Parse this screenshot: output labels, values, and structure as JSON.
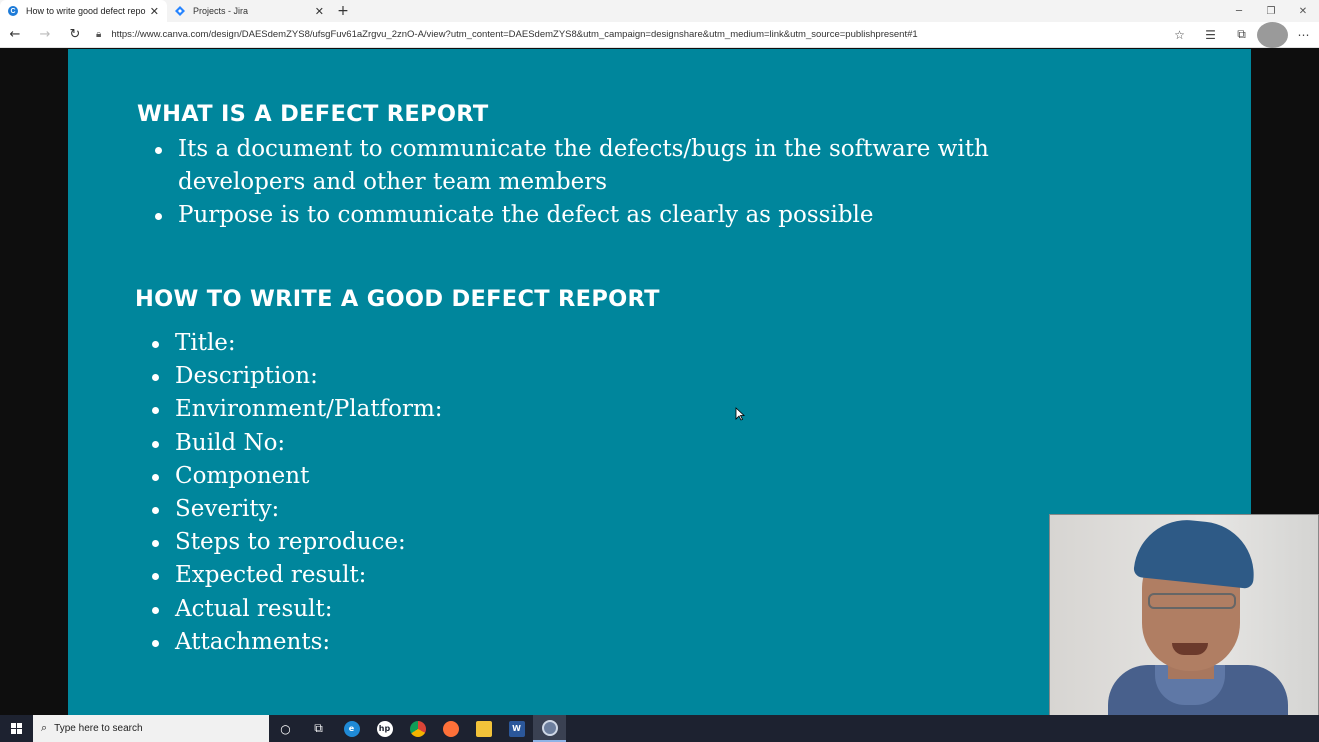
{
  "browser": {
    "tabs": [
      {
        "title": "How to write good defect report",
        "active": true,
        "icon": "canva-icon"
      },
      {
        "title": "Projects - Jira",
        "active": false,
        "icon": "jira-icon"
      }
    ],
    "url": "https://www.canva.com/design/DAESdemZYS8/ufsgFuv61aZrgvu_2znO-A/view?utm_content=DAESdemZYS8&utm_campaign=designshare&utm_medium=link&utm_source=publishpresent#1"
  },
  "slide": {
    "section1": {
      "heading": "WHAT IS A DEFECT REPORT",
      "bullets": [
        "Its a document to communicate the defects/bugs in the software with",
        "developers and other team members",
        "Purpose is to communicate the defect as clearly as possible"
      ]
    },
    "section2": {
      "heading": "HOW TO WRITE A GOOD DEFECT REPORT",
      "bullets": [
        "Title:",
        "Description:",
        "Environment/Platform:",
        "Build No:",
        "Component",
        "Severity:",
        "Steps to reproduce:",
        "Expected result:",
        "Actual result:",
        "Attachments:"
      ]
    },
    "background_color": "#00869c",
    "text_color": "#ffffff"
  },
  "taskbar": {
    "search_placeholder": "Type here to search",
    "apps": [
      "cortana-icon",
      "task-view-icon",
      "edge-icon",
      "hp-icon",
      "chrome-icon",
      "firefox-icon",
      "file-explorer-icon",
      "word-icon",
      "recorder-icon"
    ]
  }
}
